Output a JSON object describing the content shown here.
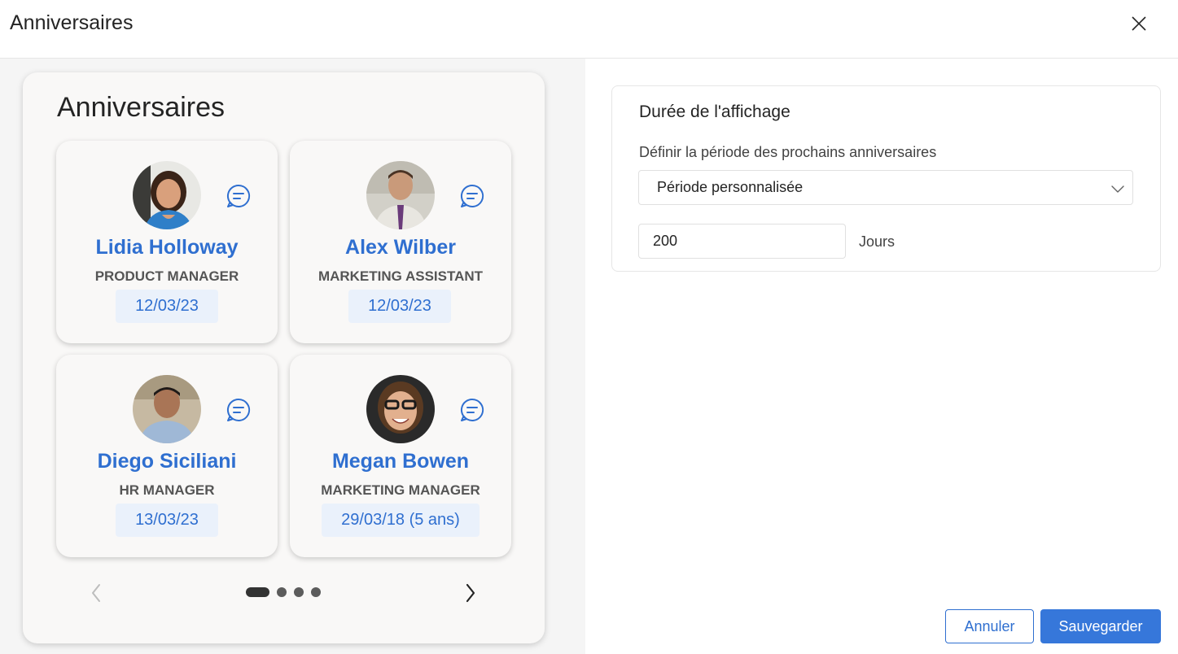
{
  "dialog": {
    "title": "Anniversaires",
    "close_icon": "close-icon"
  },
  "widget": {
    "title": "Anniversaires",
    "cards": [
      {
        "name": "Lidia Holloway",
        "role": "PRODUCT MANAGER",
        "date": "12/03/23",
        "avatar_icon": "woman-portrait"
      },
      {
        "name": "Alex Wilber",
        "role": "MARKETING ASSISTANT",
        "date": "12/03/23",
        "avatar_icon": "man-portrait"
      },
      {
        "name": "Diego Siciliani",
        "role": "HR MANAGER",
        "date": "13/03/23",
        "avatar_icon": "man-portrait"
      },
      {
        "name": "Megan Bowen",
        "role": "MARKETING MANAGER",
        "date": "29/03/18 (5 ans)",
        "avatar_icon": "woman-portrait"
      }
    ],
    "pager": {
      "pages": 4,
      "current": 1
    }
  },
  "settings": {
    "section_title": "Durée de l'affichage",
    "period_label": "Définir la période des prochains anniversaires",
    "period_value": "Période personnalisée",
    "days_value": "200",
    "days_unit": "Jours"
  },
  "footer": {
    "cancel_label": "Annuler",
    "save_label": "Sauvegarder"
  },
  "colors": {
    "accent": "#2f6fd0",
    "primary_button": "#3677da",
    "date_chip": "#eaf1fb",
    "card_bg": "#f9f8f7"
  }
}
